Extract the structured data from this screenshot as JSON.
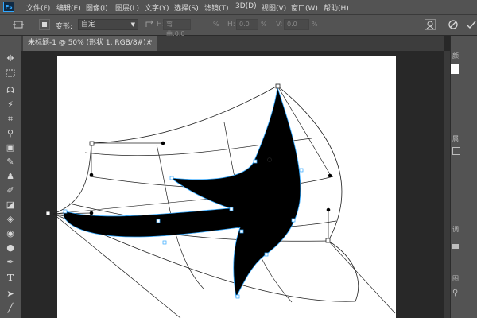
{
  "app": {
    "logo": "Ps"
  },
  "menu": {
    "items": [
      "文件(F)",
      "编辑(E)",
      "图像(I)",
      "图层(L)",
      "文字(Y)",
      "选择(S)",
      "滤镜(T)",
      "3D(D)",
      "视图(V)",
      "窗口(W)",
      "帮助(H)"
    ]
  },
  "options": {
    "transform_label": "变形:",
    "transform_value": "自定",
    "h_field_label": "H:",
    "h_field_value": "0.0",
    "bend_label": "弯曲:",
    "bend_value": "0.0",
    "h_label": "H:",
    "h_value": "0.0",
    "v_label": "V:",
    "v_value": "0.0",
    "percent": "%"
  },
  "document": {
    "tab_title": "未标题-1 @ 50% (形状 1, RGB/8#) *",
    "close": "×"
  },
  "panels": {
    "labels": [
      "颜",
      "属",
      "调",
      "图"
    ]
  },
  "colors": {
    "ui_bg": "#535353",
    "canvas_bg": "#282828",
    "document": "#ffffff",
    "shape_fill": "#000000",
    "path_accent": "#31a8ff"
  }
}
